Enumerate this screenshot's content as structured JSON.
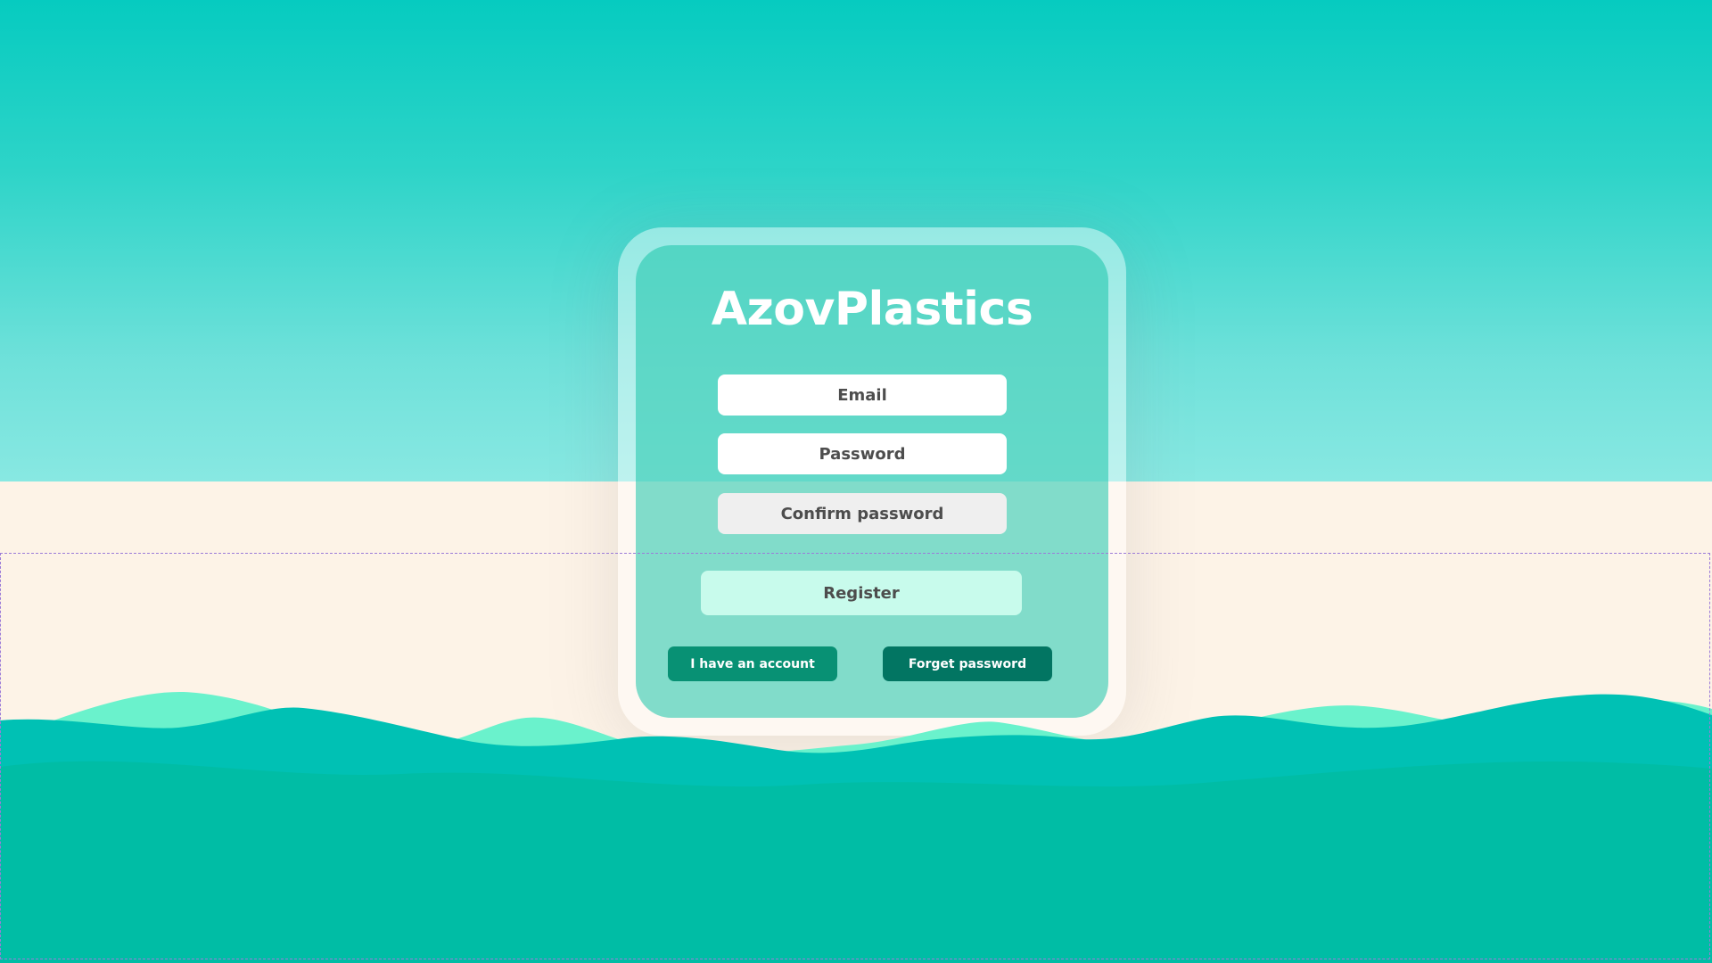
{
  "app": {
    "brand": "AzovPlastics"
  },
  "form": {
    "email_placeholder": "Email",
    "password_placeholder": "Password",
    "confirm_placeholder": "Confirm password",
    "register_label": "Register",
    "have_account_label": "I have an account",
    "forget_password_label": "Forget password"
  },
  "colors": {
    "sky_top": "#06cbc0",
    "sand": "#fdf3e7",
    "wave_teal": "#00c0a8",
    "wave_mint": "#6af2cc",
    "register_bg": "#c8fbec",
    "account_btn": "#089174",
    "forget_btn": "#027562"
  }
}
